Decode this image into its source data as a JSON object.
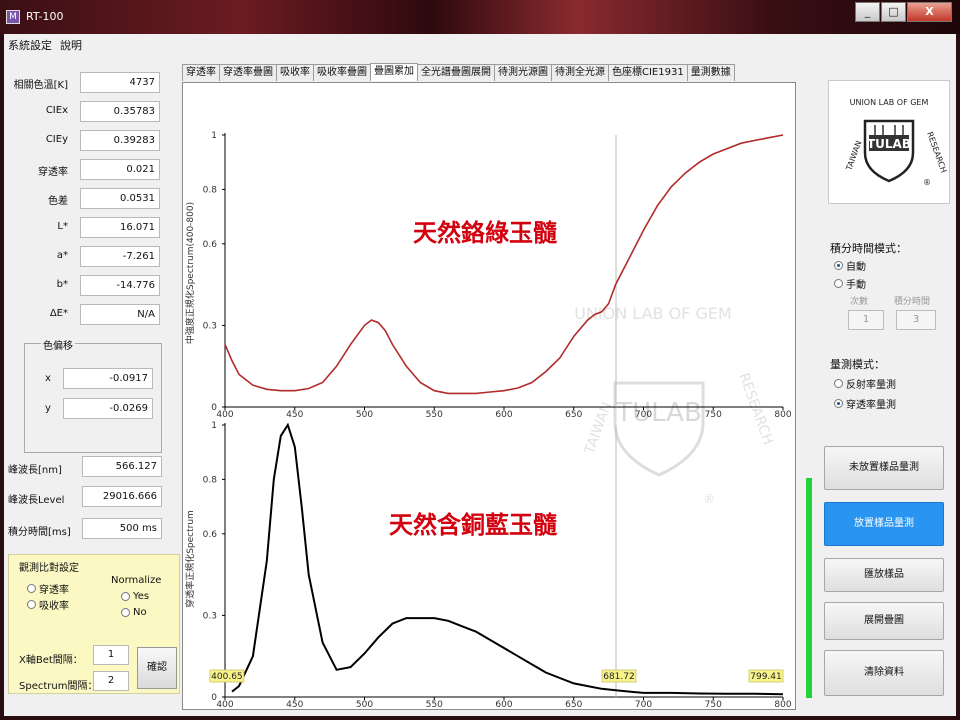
{
  "window": {
    "title": "RT-100",
    "icon": "app-icon",
    "minimize": "_",
    "maximize": "□",
    "close": "X"
  },
  "menu": [
    "系統設定",
    "說明"
  ],
  "left": {
    "fields": [
      {
        "label": "相關色溫[K]",
        "value": "4737"
      },
      {
        "label": "CIEx",
        "value": "0.35783"
      },
      {
        "label": "CIEy",
        "value": "0.39283"
      },
      {
        "label": "穿透率",
        "value": "0.021"
      },
      {
        "label": "色差",
        "value": "0.0531"
      },
      {
        "label": "L*",
        "value": "16.071"
      },
      {
        "label": "a*",
        "value": "-7.261"
      },
      {
        "label": "b*",
        "value": "-14.776"
      },
      {
        "label": "ΔE*",
        "value": "N/A"
      }
    ],
    "shift_group": {
      "title": "色偏移",
      "x_label": "x",
      "x_value": "-0.0917",
      "y_label": "y",
      "y_value": "-0.0269"
    },
    "peak_wavelength": {
      "label": "峰波長[nm]",
      "value": "566.127"
    },
    "peak_level": {
      "label": "峰波長Level",
      "value": "29016.666"
    },
    "integration": {
      "label": "積分時間[ms]",
      "value": "500 ms"
    },
    "compare": {
      "title": "觀測比對設定",
      "opt1": "穿透率",
      "opt2": "吸收率",
      "normalize_title": "Normalize",
      "yes": "Yes",
      "no": "No",
      "x_mode_label": "X軸Bet間隔：",
      "x_mode_value": "1",
      "spectrum_label": "Spectrum間隔：",
      "spectrum_value": "2",
      "confirm": "確認"
    }
  },
  "tabs": [
    "穿透率",
    "穿透率疊圖",
    "吸收率",
    "吸收率疊圖",
    "疊圖累加",
    "全光譜疊圖展開",
    "待測光源圖",
    "待測全光源",
    "色座標CIE1931",
    "量測數據"
  ],
  "active_tab": 4,
  "chart_data": [
    {
      "type": "line",
      "ylabel": "中強度正規化Spectrum(400-800)",
      "annotation": "天然鉻綠玉髓",
      "color": "#b22b2b",
      "xlim": [
        400,
        800
      ],
      "ylim": [
        0,
        1
      ],
      "yticks": [
        "1",
        "0.8",
        "0.6",
        "0.3",
        "0"
      ],
      "xticks": [
        "400",
        "450",
        "500",
        "550",
        "600",
        "650",
        "700",
        "750",
        "800"
      ],
      "cursor_x": 680,
      "x": [
        400,
        405,
        410,
        420,
        430,
        440,
        450,
        460,
        470,
        480,
        490,
        500,
        505,
        510,
        515,
        520,
        530,
        540,
        550,
        560,
        570,
        580,
        590,
        600,
        610,
        620,
        630,
        640,
        650,
        660,
        665,
        670,
        675,
        680,
        690,
        700,
        710,
        720,
        730,
        740,
        750,
        760,
        770,
        780,
        790,
        800
      ],
      "y": [
        0.23,
        0.17,
        0.12,
        0.08,
        0.065,
        0.06,
        0.06,
        0.068,
        0.09,
        0.15,
        0.23,
        0.3,
        0.32,
        0.31,
        0.28,
        0.23,
        0.15,
        0.09,
        0.06,
        0.05,
        0.05,
        0.05,
        0.055,
        0.06,
        0.07,
        0.09,
        0.13,
        0.18,
        0.26,
        0.32,
        0.34,
        0.35,
        0.38,
        0.45,
        0.55,
        0.65,
        0.74,
        0.81,
        0.86,
        0.9,
        0.93,
        0.95,
        0.97,
        0.98,
        0.99,
        1.0
      ]
    },
    {
      "type": "line",
      "ylabel": "穿透率正規化Spectrum",
      "annotation": "天然含銅藍玉髓",
      "color": "#000000",
      "xlim": [
        400,
        800
      ],
      "ylim": [
        0,
        1
      ],
      "yticks": [
        "1",
        "0.8",
        "0.6",
        "0.3",
        "0"
      ],
      "xticks": [
        "400",
        "450",
        "500",
        "550",
        "600",
        "650",
        "700",
        "750",
        "800"
      ],
      "cursor_x": 680,
      "labels": [
        "400.65",
        "681.72",
        "799.41"
      ],
      "x": [
        405,
        410,
        420,
        430,
        435,
        440,
        445,
        450,
        455,
        460,
        470,
        480,
        490,
        500,
        510,
        520,
        530,
        540,
        550,
        560,
        570,
        580,
        590,
        600,
        610,
        620,
        630,
        640,
        650,
        660,
        670,
        680,
        690,
        700,
        720,
        740,
        760,
        780,
        800
      ],
      "y": [
        0.02,
        0.04,
        0.15,
        0.5,
        0.8,
        0.96,
        1.0,
        0.92,
        0.7,
        0.45,
        0.2,
        0.1,
        0.11,
        0.16,
        0.22,
        0.27,
        0.29,
        0.29,
        0.29,
        0.28,
        0.26,
        0.24,
        0.21,
        0.18,
        0.15,
        0.12,
        0.09,
        0.07,
        0.05,
        0.04,
        0.03,
        0.025,
        0.02,
        0.015,
        0.015,
        0.013,
        0.012,
        0.012,
        0.01
      ]
    }
  ],
  "watermark": {
    "top": "UNION LAB OF GEM",
    "left": "TAIWAN",
    "right": "RESEARCH",
    "center": "TULAB",
    "mark": "®"
  },
  "right": {
    "logo": {
      "top": "UNION LAB OF GEM",
      "left": "TAIWAN",
      "right": "RESEARCH",
      "center": "TULAB",
      "mark": "®"
    },
    "integ_title": "積分時間模式：",
    "auto": "自動",
    "manual": "手動",
    "count_label": "次數",
    "time_label": "積分時間",
    "count_value": "1",
    "time_value": "3",
    "measure_title": "量測模式：",
    "reflect": "反射率量測",
    "transmit": "穿透率量測",
    "btn1": "未放置樣品量測",
    "btn2": "放置樣品量測",
    "btn3": "匯放樣品",
    "btn4": "展開疊圖",
    "btn5": "清除資料"
  }
}
